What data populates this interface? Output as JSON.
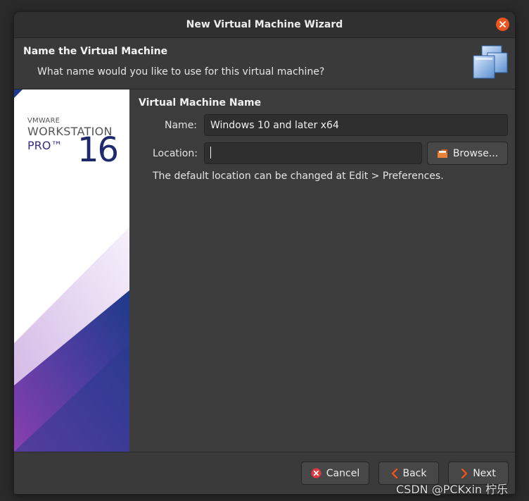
{
  "window": {
    "title": "New Virtual Machine Wizard"
  },
  "header": {
    "title": "Name the Virtual Machine",
    "subtitle": "What name would you like to use for this virtual machine?"
  },
  "brand": {
    "vendor": "VMWARE",
    "product": "WORKSTATION",
    "edition": "PRO™",
    "version": "16"
  },
  "section": {
    "title": "Virtual Machine Name"
  },
  "form": {
    "name_label": "Name:",
    "name_value": "Windows 10 and later x64",
    "location_label": "Location:",
    "location_value": "",
    "browse_label": "Browse...",
    "note": "The default location can be changed at Edit > Preferences."
  },
  "footer": {
    "cancel_label": "Cancel",
    "back_label": "Back",
    "next_label": "Next"
  },
  "watermark": "CSDN @PCKxin 柠乐",
  "colors": {
    "accent": "#e95420",
    "cancel_icon": "#e0393e",
    "dialog_bg": "#3c3c3c",
    "brand_blue": "#1d3a8a",
    "brand_purple": "#7a3fa8"
  },
  "icons": {
    "close": "close-icon",
    "header": "vm-stack-icon",
    "browse": "folder-icon",
    "cancel": "cancel-circle-icon",
    "back": "chevron-left-icon",
    "next": "chevron-right-icon"
  }
}
